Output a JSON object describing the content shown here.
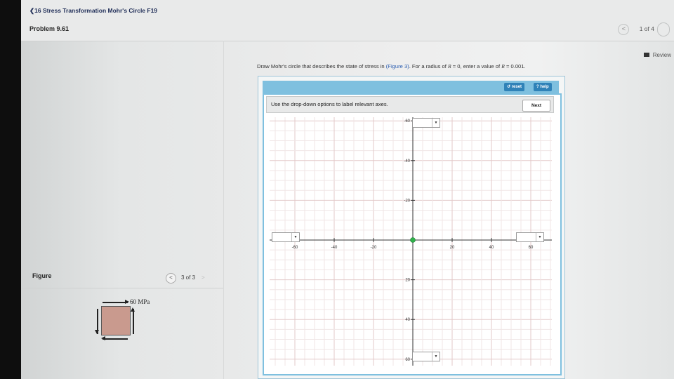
{
  "header": {
    "back_label": "❮16 Stress Transformation Mohr's Circle F19",
    "problem_title": "Problem 9.61",
    "pager_text": "1 of 4"
  },
  "review_label": "Review",
  "question": {
    "text_before": "Draw Mohr's circle that describes the state of stress in ",
    "figure_link": "(Figure 3)",
    "text_mid": ". For a radius of ",
    "r_sym": "R",
    "eq0": " = 0, enter a value of ",
    "r_sym2": "R",
    "eq1": " = 0.001."
  },
  "figure_panel": {
    "label": "Figure",
    "pager": "3 of 3",
    "stress_label": "60 MPa",
    "box_color": "#c99a8e"
  },
  "tool": {
    "reset_label": "↺ reset",
    "help_label": "? help",
    "instruction": "Use the drop-down options to label relevant axes.",
    "next_label": "Next",
    "accent_color": "#7fc0df"
  },
  "chart_data": {
    "type": "scatter",
    "x_ticks": [
      "-60",
      "-40",
      "-20",
      "20",
      "40",
      "60"
    ],
    "y_ticks": [
      "-60",
      "-40",
      "-20",
      "20",
      "40",
      "60"
    ],
    "xlim": [
      -60,
      60
    ],
    "ylim": [
      -60,
      60
    ],
    "grid": true,
    "points": [
      {
        "x": 0,
        "y": 0,
        "color": "#2fb24a"
      }
    ],
    "axis_dropdowns": [
      "top",
      "bottom",
      "left",
      "right"
    ]
  }
}
